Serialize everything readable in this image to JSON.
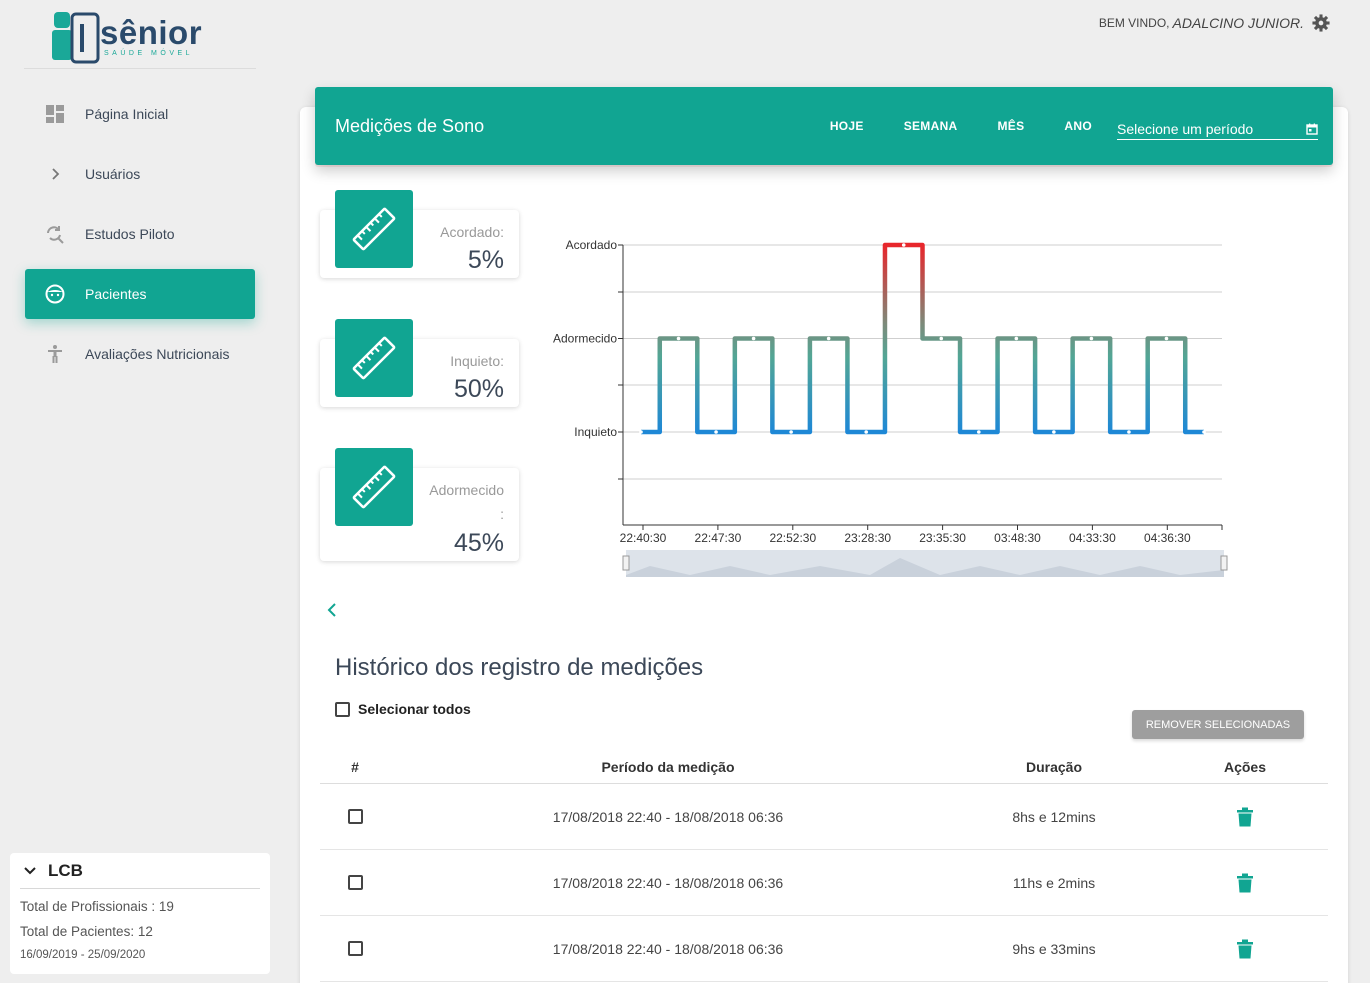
{
  "brand": {
    "name": "sênior",
    "tagline": "SAÚDE MÓVEL"
  },
  "header": {
    "welcome": "BEM VINDO,",
    "user": "ADALCINO JUNIOR."
  },
  "sidebar": {
    "items": [
      {
        "label": "Página Inicial",
        "icon": "dashboard-icon"
      },
      {
        "label": "Usuários",
        "icon": "chevron-right-icon"
      },
      {
        "label": "Estudos Piloto",
        "icon": "refresh-search-icon"
      },
      {
        "label": "Pacientes",
        "icon": "face-icon",
        "active": true
      },
      {
        "label": "Avaliações Nutricionais",
        "icon": "accessibility-icon"
      }
    ],
    "org_card": {
      "title": "LCB",
      "professionals": "Total de Profissionais : 19",
      "patients": "Total de Pacientes: 12",
      "date_range": "16/09/2019 - 25/09/2020"
    }
  },
  "main": {
    "title": "Medições de Sono",
    "periods": [
      "HOJE",
      "SEMANA",
      "MÊS",
      "ANO"
    ],
    "period_select_placeholder": "Selecione um período",
    "stats": [
      {
        "label": "Acordado:",
        "value": "5%"
      },
      {
        "label": "Inquieto:",
        "value": "50%"
      },
      {
        "label": "Adormecido",
        "label_suffix": ":",
        "value": "45%"
      }
    ],
    "history_title": "Histórico dos registro de medições",
    "select_all": "Selecionar todos",
    "remove_selected": "REMOVER SELECIONADAS",
    "table": {
      "headers": [
        "#",
        "Período da medição",
        "Duração",
        "Ações"
      ],
      "rows": [
        {
          "period": "17/08/2018 22:40 - 18/08/2018 06:36",
          "duration": "8hs e 12mins"
        },
        {
          "period": "17/08/2018 22:40 - 18/08/2018 06:36",
          "duration": "11hs e 2mins"
        },
        {
          "period": "17/08/2018 22:40 - 18/08/2018 06:36",
          "duration": "9hs e 33mins"
        }
      ]
    }
  },
  "colors": {
    "accent": "#11a592",
    "awake": "#e8262b",
    "restless": "#1e88d6"
  },
  "chart_data": {
    "type": "line",
    "step": true,
    "y_categories": [
      "Inquieto",
      "Adormecido",
      "Acordado"
    ],
    "x_ticks": [
      "22:40:30",
      "22:47:30",
      "22:52:30",
      "23:28:30",
      "23:35:30",
      "03:48:30",
      "04:33:30",
      "04:36:30"
    ],
    "series": [
      {
        "values": [
          "Inquieto",
          "Adormecido",
          "Inquieto",
          "Adormecido",
          "Inquieto",
          "Adormecido",
          "Inquieto",
          "Acordado",
          "Adormecido",
          "Inquieto",
          "Adormecido",
          "Inquieto",
          "Adormecido",
          "Inquieto",
          "Adormecido",
          "Inquieto"
        ]
      }
    ],
    "grid": true,
    "navigator": true
  }
}
